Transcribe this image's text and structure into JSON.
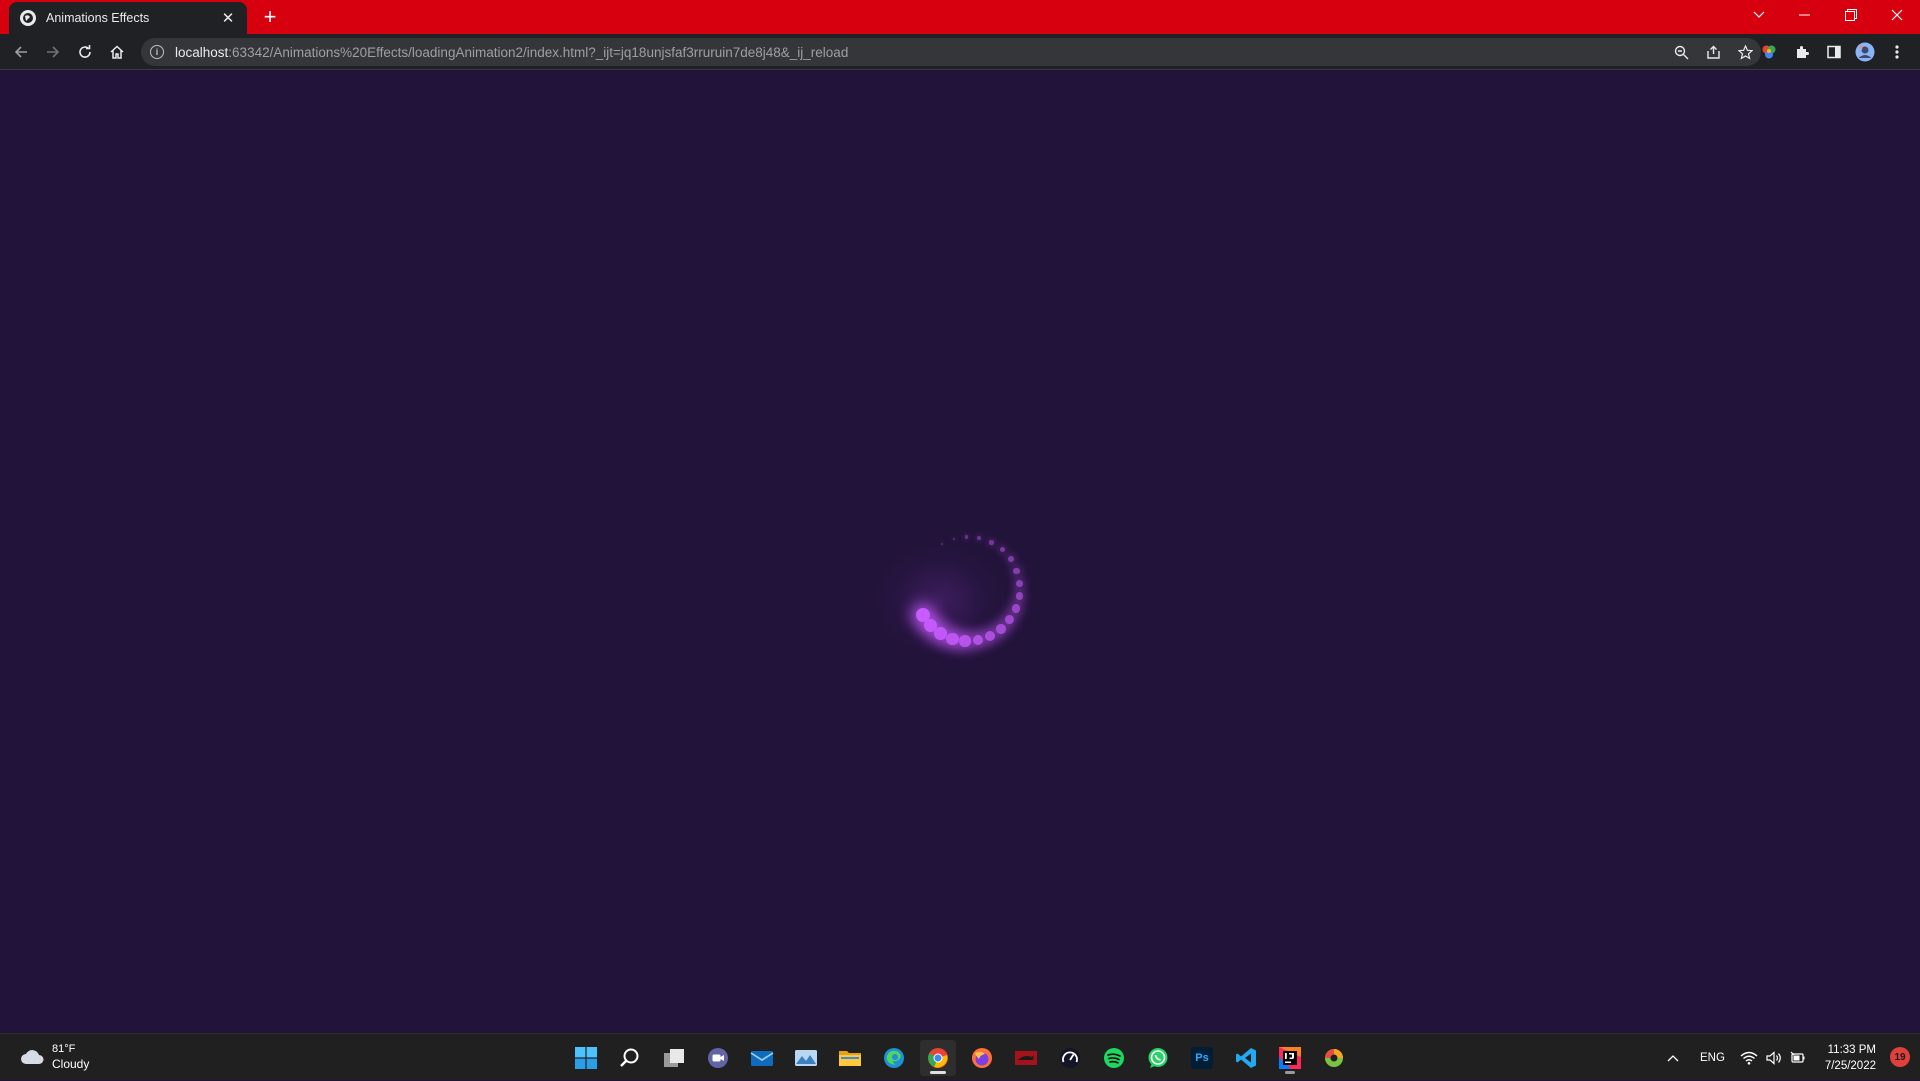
{
  "browser": {
    "tab": {
      "title": "Animations Effects",
      "close": "✕"
    },
    "new_tab": "+",
    "url": {
      "host": "localhost",
      "rest": ":63342/Animations%20Effects/loadingAnimation2/index.html?_ijt=jq18unjsfaf3rruruin7de8j48&_ij_reload"
    },
    "info_icon": "i",
    "colors": {
      "tab_strip": "#d6000f",
      "toolbar": "#202124",
      "omnibox": "#35363a"
    }
  },
  "page": {
    "background": "#22133a",
    "loader": {
      "dot_color": "#c85cff",
      "dot_count": 20,
      "state": "loading"
    }
  },
  "taskbar": {
    "weather": {
      "temp": "81°F",
      "condition": "Cloudy"
    },
    "apps": [
      "start-icon",
      "search-icon",
      "task-view-icon",
      "teams-chat-icon",
      "mail-icon",
      "photos-icon",
      "file-explorer-icon",
      "edge-icon",
      "chrome-icon",
      "firefox-icon",
      "flixster-icon",
      "speedtest-icon",
      "spotify-icon",
      "whatsapp-icon",
      "photoshop-icon",
      "vscode-icon",
      "intellij-icon",
      "colorful-app-icon"
    ],
    "photoshop_label": "Ps",
    "tray": {
      "language": "ENG",
      "chevron": "^"
    },
    "clock": {
      "time": "11:33 PM",
      "date": "7/25/2022"
    },
    "notifications": "19"
  }
}
